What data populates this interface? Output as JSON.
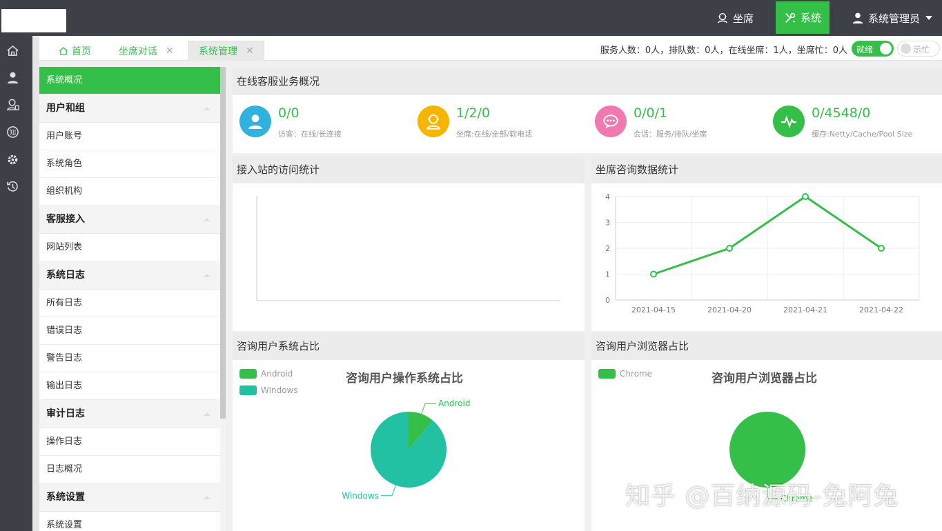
{
  "header": {
    "nav": [
      {
        "label": "坐席",
        "icon": "headset-icon"
      },
      {
        "label": "系统",
        "icon": "tools-icon",
        "active": true
      },
      {
        "label": "系统管理员",
        "icon": "user-icon"
      }
    ]
  },
  "tabs": [
    {
      "label": "首页"
    },
    {
      "label": "坐席对话"
    },
    {
      "label": "系统管理",
      "active": true
    }
  ],
  "status": {
    "text": "服务人数：0人，排队数：0人，在线坐席：1人，坐席忙：0人",
    "ready_label": "就绪",
    "busy_label": "示忙"
  },
  "menu": {
    "items": [
      {
        "type": "item",
        "label": "系统概况",
        "active": true
      },
      {
        "type": "group",
        "label": "用户和组"
      },
      {
        "type": "item",
        "label": "用户账号"
      },
      {
        "type": "item",
        "label": "系统角色"
      },
      {
        "type": "item",
        "label": "组织机构"
      },
      {
        "type": "group",
        "label": "客服接入"
      },
      {
        "type": "item",
        "label": "网站列表"
      },
      {
        "type": "group",
        "label": "系统日志"
      },
      {
        "type": "item",
        "label": "所有日志"
      },
      {
        "type": "item",
        "label": "错误日志"
      },
      {
        "type": "item",
        "label": "警告日志"
      },
      {
        "type": "item",
        "label": "输出日志"
      },
      {
        "type": "group",
        "label": "审计日志"
      },
      {
        "type": "item",
        "label": "操作日志"
      },
      {
        "type": "item",
        "label": "日志概况"
      },
      {
        "type": "group",
        "label": "系统设置"
      },
      {
        "type": "item",
        "label": "系统设置"
      }
    ]
  },
  "overview": {
    "title": "在线客服业务概况",
    "kpis": [
      {
        "value": "0/0",
        "desc": "访客：在线/长连接",
        "color": "#2fb2e0",
        "icon": "visitor-icon"
      },
      {
        "value": "1/2/0",
        "desc": "坐席:在线/全部/软电话",
        "color": "#f7b500",
        "icon": "agent-icon"
      },
      {
        "value": "0/0/1",
        "desc": "会话：服务/排队/坐席",
        "color": "#f07ab0",
        "icon": "chat-icon"
      },
      {
        "value": "0/4548/0",
        "desc": "缓存:Netty/Cache/Pool Size",
        "color": "#34bf49",
        "icon": "pulse-icon"
      }
    ]
  },
  "panels": {
    "site_visits": "接入站的访问统计",
    "agent_stats": "坐席咨询数据统计",
    "os_share": "咨询用户系统占比",
    "browser_share": "咨询用户浏览器占比"
  },
  "chart_data": [
    {
      "type": "line",
      "categories": [
        "2021-04-15",
        "2021-04-20",
        "2021-04-21",
        "2021-04-22"
      ],
      "values": [
        1,
        2,
        4,
        2
      ],
      "ylim": [
        0,
        4
      ],
      "yticks": [
        "0",
        "1",
        "2",
        "3",
        "4"
      ],
      "color": "#34bf49",
      "grid": true
    },
    {
      "type": "pie",
      "title": "咨询用户操作系统占比",
      "slices": [
        {
          "label": "Android",
          "value": 11,
          "color": "#34bf49"
        },
        {
          "label": "Windows",
          "value": 89,
          "color": "#22c1a4"
        }
      ],
      "legend": "top-left"
    },
    {
      "type": "pie",
      "title": "咨询用户浏览器占比",
      "slices": [
        {
          "label": "Chrome",
          "value": 100,
          "color": "#34bf49"
        }
      ],
      "legend": "top-left"
    }
  ],
  "watermark": "知乎 @百纳源码-兔阿兔"
}
